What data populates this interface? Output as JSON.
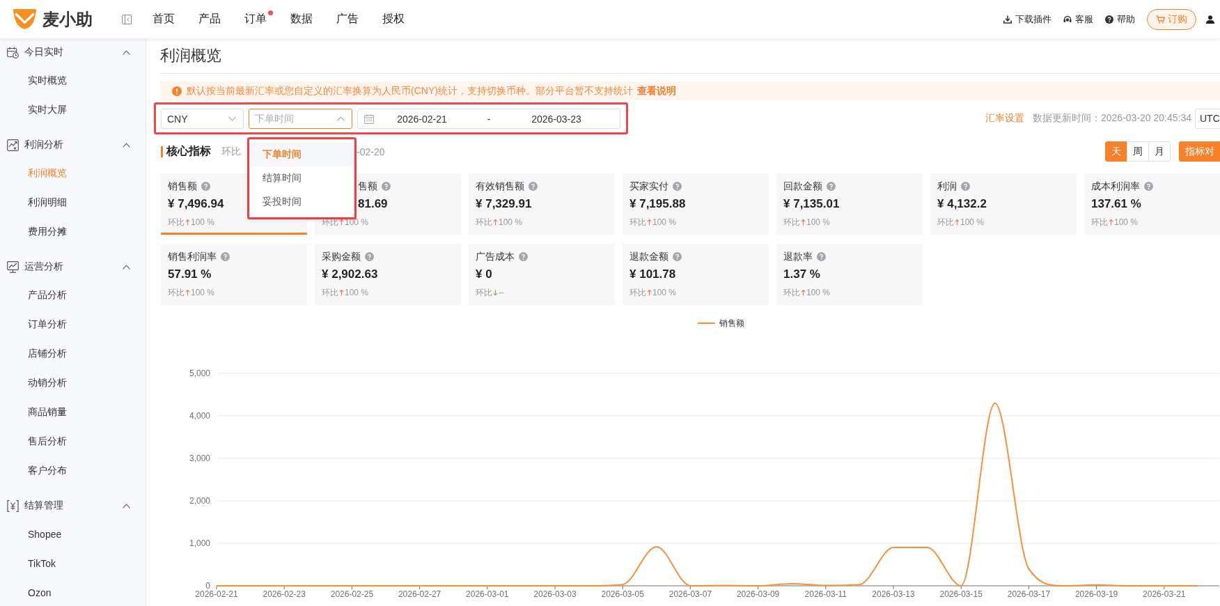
{
  "app": {
    "name": "麦小助"
  },
  "nav": [
    {
      "label": "首页",
      "dot": false
    },
    {
      "label": "产品",
      "dot": false
    },
    {
      "label": "订单",
      "dot": true
    },
    {
      "label": "数据",
      "dot": false
    },
    {
      "label": "广告",
      "dot": false
    },
    {
      "label": "授权",
      "dot": false
    }
  ],
  "header_actions": [
    {
      "label": "下载插件",
      "kind": "download"
    },
    {
      "label": "客服",
      "kind": "service"
    },
    {
      "label": "帮助",
      "kind": "help"
    }
  ],
  "order_button": {
    "label": "订购"
  },
  "sidebar": {
    "groups": [
      {
        "label": "今日实时",
        "kind": "calendar",
        "expanded": true,
        "children": [
          {
            "label": "实时概览",
            "selected": false
          },
          {
            "label": "实时大屏",
            "selected": false
          }
        ]
      },
      {
        "label": "利润分析",
        "kind": "profit",
        "expanded": true,
        "children": [
          {
            "label": "利润概览",
            "selected": true
          },
          {
            "label": "利润明细",
            "selected": false
          },
          {
            "label": "费用分摊",
            "selected": false
          }
        ]
      },
      {
        "label": "运营分析",
        "kind": "trend",
        "expanded": true,
        "children": [
          {
            "label": "产品分析",
            "selected": false
          },
          {
            "label": "订单分析",
            "selected": false
          },
          {
            "label": "店铺分析",
            "selected": false
          },
          {
            "label": "动销分析",
            "selected": false
          },
          {
            "label": "商品销量",
            "selected": false
          },
          {
            "label": "售后分析",
            "selected": false
          },
          {
            "label": "客户分布",
            "selected": false
          }
        ]
      },
      {
        "label": "结算管理",
        "kind": "settlement",
        "expanded": true,
        "children": [
          {
            "label": "Shopee",
            "selected": false
          },
          {
            "label": "TikTok",
            "selected": false
          },
          {
            "label": "Ozon",
            "selected": false
          }
        ]
      }
    ]
  },
  "page": {
    "title": "利润概览",
    "notice": {
      "text": "默认按当前最新汇率或您自定义的汇率换算为人民币(CNY)统计，支持切换币种。部分平台暂不支持统计",
      "link": "查看说明"
    }
  },
  "filters": {
    "highlighted": true,
    "currency": {
      "value": "CNY"
    },
    "time_type": {
      "placeholder": "下单时间",
      "expanded": true,
      "menu_highlighted": true,
      "options": [
        {
          "label": "下单时间",
          "selected": true
        },
        {
          "label": "结算时间",
          "selected": false
        },
        {
          "label": "妥投时间",
          "selected": false
        }
      ]
    },
    "date_range": {
      "start": "2026-02-21",
      "separator": "-",
      "end": "2026-03-23"
    }
  },
  "toolbar": {
    "rate_link": "汇率设置",
    "update_time": "数据更新时间：2026-03-20 20:45:34",
    "timezone": "UTC"
  },
  "core_metrics": {
    "title": "核心指标",
    "compare_left": "环比",
    "compare_right": "-02-20",
    "granularity": [
      {
        "label": "天",
        "selected": true
      },
      {
        "label": "周",
        "selected": false
      },
      {
        "label": "月",
        "selected": false
      }
    ],
    "compare_button": "指标对",
    "cards": [
      {
        "kind": "metric",
        "label": "销售额",
        "value": "¥ 7,496.94",
        "delta_label": "环比",
        "rising": true,
        "delta": "100 %",
        "selected": true
      },
      {
        "kind": "covered",
        "label": "售额",
        "value": "81.69",
        "delta_label": "环比",
        "rising": true,
        "delta": "100 %",
        "selected": false
      },
      {
        "kind": "metric",
        "label": "有效销售额",
        "value": "¥ 7,329.91",
        "delta_label": "环比",
        "rising": true,
        "delta": "100 %",
        "selected": false
      },
      {
        "kind": "metric",
        "label": "买家实付",
        "value": "¥ 7,195.88",
        "delta_label": "环比",
        "rising": true,
        "delta": "100 %",
        "selected": false
      },
      {
        "kind": "metric",
        "label": "回款金额",
        "value": "¥ 7,135.01",
        "delta_label": "环比",
        "rising": true,
        "delta": "100 %",
        "selected": false
      },
      {
        "kind": "metric",
        "label": "利润",
        "value": "¥ 4,132.2",
        "delta_label": "环比",
        "rising": true,
        "delta": "100 %",
        "selected": false
      },
      {
        "kind": "metric",
        "label": "成本利润率",
        "value": "137.61 %",
        "delta_label": "环比",
        "rising": true,
        "delta": "100 %",
        "selected": false
      },
      {
        "kind": "metric",
        "label": "销售利润率",
        "value": "57.91 %",
        "delta_label": "环比",
        "rising": true,
        "delta": "100 %",
        "selected": false
      },
      {
        "kind": "metric",
        "label": "采购金额",
        "value": "¥ 2,902.63",
        "delta_label": "环比",
        "rising": true,
        "delta": "100 %",
        "selected": false
      },
      {
        "kind": "metric",
        "label": "广告成本",
        "value": "¥ 0",
        "delta_label": "环比",
        "rising": false,
        "delta": "--",
        "selected": false
      },
      {
        "kind": "metric",
        "label": "退款金额",
        "value": "¥ 101.78",
        "delta_label": "环比",
        "rising": true,
        "delta": "100 %",
        "selected": false
      },
      {
        "kind": "metric",
        "label": "退款率",
        "value": "1.37 %",
        "delta_label": "环比",
        "rising": true,
        "delta": "100 %",
        "selected": false
      }
    ]
  },
  "chart": {
    "chart_data": {
      "type": "line",
      "grid": true,
      "categories": [
        "2026-02-21",
        null,
        "2026-02-23",
        null,
        "2026-02-25",
        null,
        "2026-02-27",
        null,
        "2026-03-01",
        null,
        "2026-03-03",
        null,
        "2026-03-05",
        null,
        "2026-03-07",
        null,
        "2026-03-09",
        null,
        "2026-03-11",
        null,
        "2026-03-13",
        null,
        "2026-03-15",
        null,
        "2026-03-17",
        null,
        "2026-03-19",
        null,
        "2026-03-21",
        null
      ],
      "series": [
        {
          "name": "销售额",
          "color": "#f7903c",
          "values": [
            0,
            0,
            0,
            0,
            0,
            0,
            0,
            0,
            0,
            0,
            0,
            0,
            30,
            920,
            0,
            10,
            0,
            50,
            10,
            30,
            900,
            900,
            0,
            4300,
            400,
            0,
            20,
            0,
            0,
            0
          ]
        }
      ],
      "ylim": [
        0,
        5000
      ],
      "yticks": [
        {
          "value": 0,
          "label": "0"
        },
        {
          "value": 1000,
          "label": "1,000"
        },
        {
          "value": 2000,
          "label": "2,000"
        },
        {
          "value": 3000,
          "label": "3,000"
        },
        {
          "value": 4000,
          "label": "4,000"
        },
        {
          "value": 5000,
          "label": "5,000"
        }
      ]
    }
  }
}
